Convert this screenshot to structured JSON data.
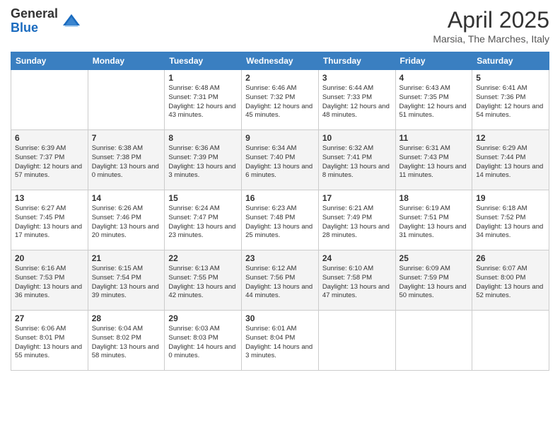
{
  "header": {
    "logo_general": "General",
    "logo_blue": "Blue",
    "month": "April 2025",
    "location": "Marsia, The Marches, Italy"
  },
  "weekdays": [
    "Sunday",
    "Monday",
    "Tuesday",
    "Wednesday",
    "Thursday",
    "Friday",
    "Saturday"
  ],
  "weeks": [
    [
      {
        "day": "",
        "info": ""
      },
      {
        "day": "",
        "info": ""
      },
      {
        "day": "1",
        "info": "Sunrise: 6:48 AM\nSunset: 7:31 PM\nDaylight: 12 hours and 43 minutes."
      },
      {
        "day": "2",
        "info": "Sunrise: 6:46 AM\nSunset: 7:32 PM\nDaylight: 12 hours and 45 minutes."
      },
      {
        "day": "3",
        "info": "Sunrise: 6:44 AM\nSunset: 7:33 PM\nDaylight: 12 hours and 48 minutes."
      },
      {
        "day": "4",
        "info": "Sunrise: 6:43 AM\nSunset: 7:35 PM\nDaylight: 12 hours and 51 minutes."
      },
      {
        "day": "5",
        "info": "Sunrise: 6:41 AM\nSunset: 7:36 PM\nDaylight: 12 hours and 54 minutes."
      }
    ],
    [
      {
        "day": "6",
        "info": "Sunrise: 6:39 AM\nSunset: 7:37 PM\nDaylight: 12 hours and 57 minutes."
      },
      {
        "day": "7",
        "info": "Sunrise: 6:38 AM\nSunset: 7:38 PM\nDaylight: 13 hours and 0 minutes."
      },
      {
        "day": "8",
        "info": "Sunrise: 6:36 AM\nSunset: 7:39 PM\nDaylight: 13 hours and 3 minutes."
      },
      {
        "day": "9",
        "info": "Sunrise: 6:34 AM\nSunset: 7:40 PM\nDaylight: 13 hours and 6 minutes."
      },
      {
        "day": "10",
        "info": "Sunrise: 6:32 AM\nSunset: 7:41 PM\nDaylight: 13 hours and 8 minutes."
      },
      {
        "day": "11",
        "info": "Sunrise: 6:31 AM\nSunset: 7:43 PM\nDaylight: 13 hours and 11 minutes."
      },
      {
        "day": "12",
        "info": "Sunrise: 6:29 AM\nSunset: 7:44 PM\nDaylight: 13 hours and 14 minutes."
      }
    ],
    [
      {
        "day": "13",
        "info": "Sunrise: 6:27 AM\nSunset: 7:45 PM\nDaylight: 13 hours and 17 minutes."
      },
      {
        "day": "14",
        "info": "Sunrise: 6:26 AM\nSunset: 7:46 PM\nDaylight: 13 hours and 20 minutes."
      },
      {
        "day": "15",
        "info": "Sunrise: 6:24 AM\nSunset: 7:47 PM\nDaylight: 13 hours and 23 minutes."
      },
      {
        "day": "16",
        "info": "Sunrise: 6:23 AM\nSunset: 7:48 PM\nDaylight: 13 hours and 25 minutes."
      },
      {
        "day": "17",
        "info": "Sunrise: 6:21 AM\nSunset: 7:49 PM\nDaylight: 13 hours and 28 minutes."
      },
      {
        "day": "18",
        "info": "Sunrise: 6:19 AM\nSunset: 7:51 PM\nDaylight: 13 hours and 31 minutes."
      },
      {
        "day": "19",
        "info": "Sunrise: 6:18 AM\nSunset: 7:52 PM\nDaylight: 13 hours and 34 minutes."
      }
    ],
    [
      {
        "day": "20",
        "info": "Sunrise: 6:16 AM\nSunset: 7:53 PM\nDaylight: 13 hours and 36 minutes."
      },
      {
        "day": "21",
        "info": "Sunrise: 6:15 AM\nSunset: 7:54 PM\nDaylight: 13 hours and 39 minutes."
      },
      {
        "day": "22",
        "info": "Sunrise: 6:13 AM\nSunset: 7:55 PM\nDaylight: 13 hours and 42 minutes."
      },
      {
        "day": "23",
        "info": "Sunrise: 6:12 AM\nSunset: 7:56 PM\nDaylight: 13 hours and 44 minutes."
      },
      {
        "day": "24",
        "info": "Sunrise: 6:10 AM\nSunset: 7:58 PM\nDaylight: 13 hours and 47 minutes."
      },
      {
        "day": "25",
        "info": "Sunrise: 6:09 AM\nSunset: 7:59 PM\nDaylight: 13 hours and 50 minutes."
      },
      {
        "day": "26",
        "info": "Sunrise: 6:07 AM\nSunset: 8:00 PM\nDaylight: 13 hours and 52 minutes."
      }
    ],
    [
      {
        "day": "27",
        "info": "Sunrise: 6:06 AM\nSunset: 8:01 PM\nDaylight: 13 hours and 55 minutes."
      },
      {
        "day": "28",
        "info": "Sunrise: 6:04 AM\nSunset: 8:02 PM\nDaylight: 13 hours and 58 minutes."
      },
      {
        "day": "29",
        "info": "Sunrise: 6:03 AM\nSunset: 8:03 PM\nDaylight: 14 hours and 0 minutes."
      },
      {
        "day": "30",
        "info": "Sunrise: 6:01 AM\nSunset: 8:04 PM\nDaylight: 14 hours and 3 minutes."
      },
      {
        "day": "",
        "info": ""
      },
      {
        "day": "",
        "info": ""
      },
      {
        "day": "",
        "info": ""
      }
    ]
  ]
}
